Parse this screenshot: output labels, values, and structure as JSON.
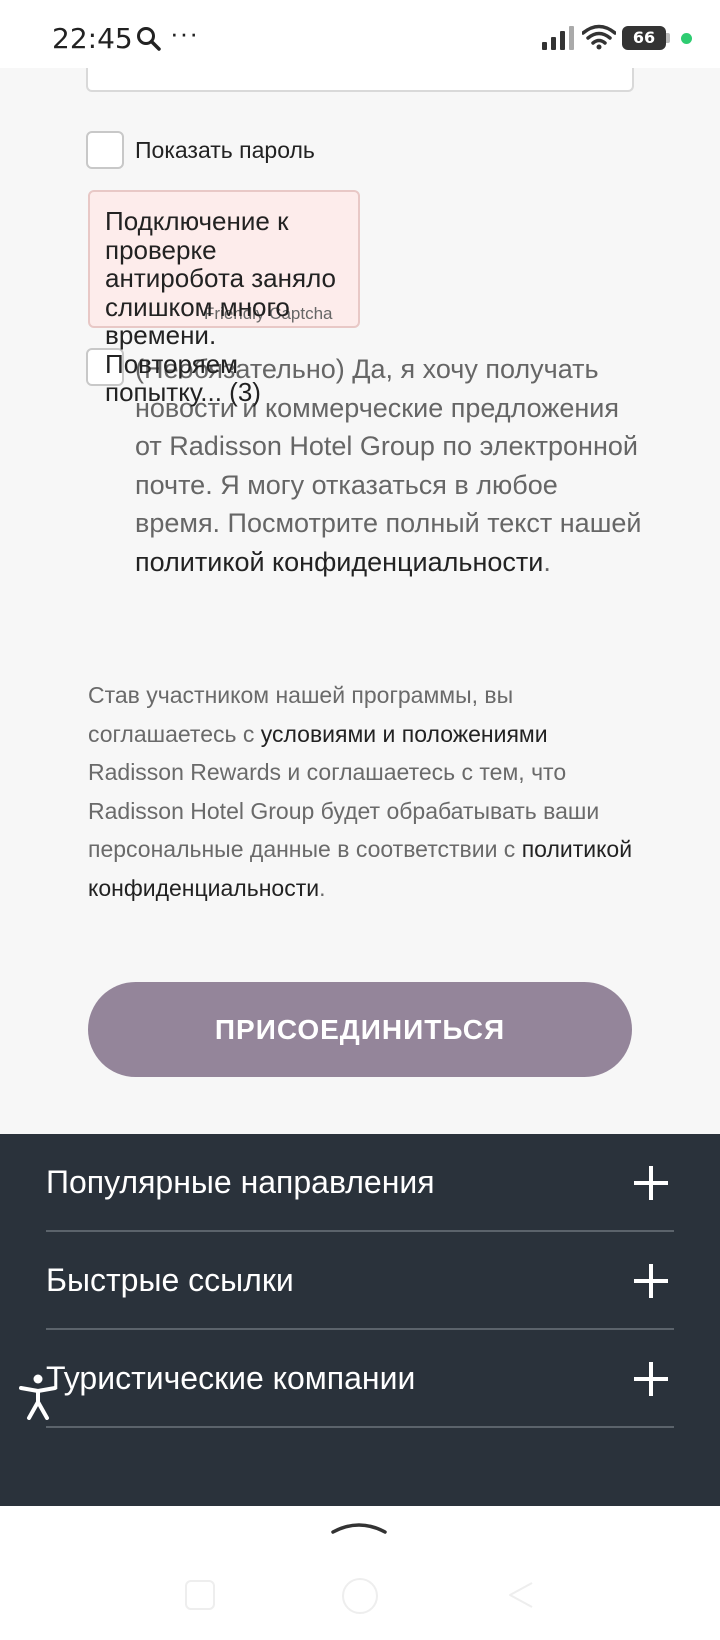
{
  "status_bar": {
    "time": "22:45",
    "more_glyph": "···",
    "battery": "66",
    "icons": [
      "search-icon",
      "more-icon",
      "signal-icon",
      "wifi-icon",
      "battery-icon",
      "green-dot-icon"
    ]
  },
  "form": {
    "show_password_label": "Показать пароль",
    "captcha": {
      "message": "Подключение к проверке антиробота заняло слишком много времени. Повторяем попытку... (3)",
      "brand": "Friendly Captcha"
    },
    "newsletter": {
      "text": "(Необязательно) Да, я хочу получать новости и коммерческие предложения от Radisson Hotel Group по электронной почте. Я могу отказаться в любое время. Посмотрите полный текст нашей",
      "link": "политикой конфиденциальности",
      "end": "."
    },
    "terms": {
      "part1": "Став участником нашей программы, вы соглашаетесь с",
      "link1": "условиями и положениями",
      "part2": "Radisson Rewards и соглашаетесь с тем, что Radisson Hotel Group будет обрабатывать ваши персональные данные в соответствии с",
      "link2": "политикой конфиденциальности",
      "end": "."
    },
    "join_button": "ПРИСОЕДИНИТЬСЯ"
  },
  "footer": {
    "items": [
      {
        "label": "Популярные направления"
      },
      {
        "label": "Быстрые ссылки"
      },
      {
        "label": "Туристические компании"
      }
    ]
  },
  "colors": {
    "join_button": "#94859a",
    "footer_bg": "#2a323b",
    "captcha_bg": "#fdeceb"
  }
}
